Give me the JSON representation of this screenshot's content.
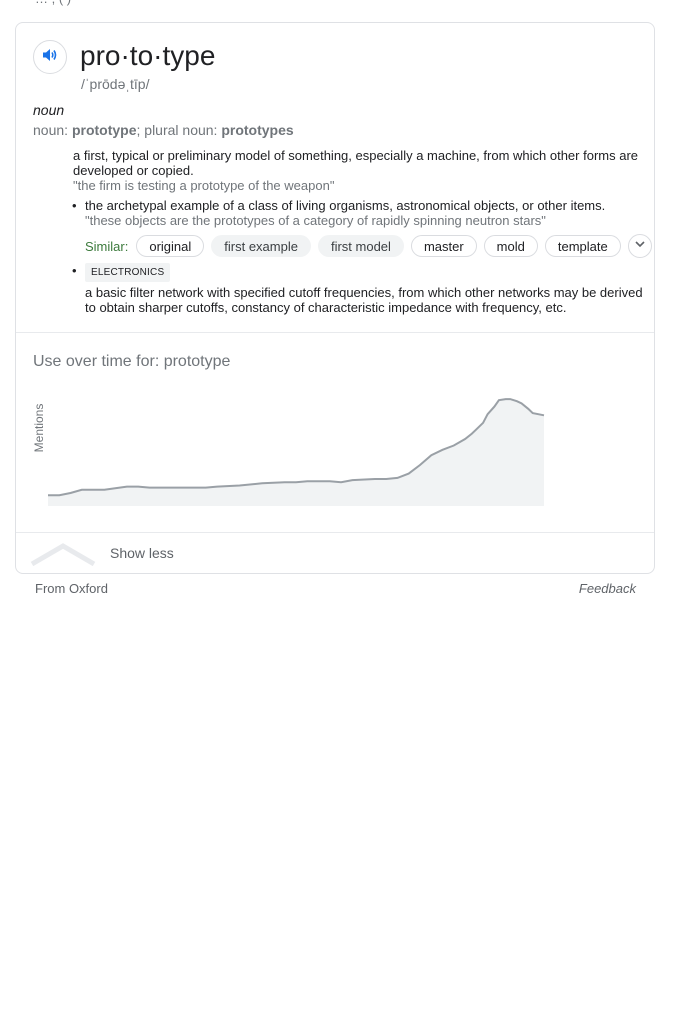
{
  "top_fragment": "…  ,  (             )",
  "entry": {
    "headword": "pro·to·type",
    "pronunciation": "/ˈprōdəˌtīp/",
    "part_of_speech": "noun",
    "forms": {
      "prefix": "noun: ",
      "singular": "prototype",
      "sep": "; plural noun: ",
      "plural": "prototypes"
    },
    "definitions": [
      {
        "text": "a first, typical or preliminary model of something, especially a machine, from which other forms are developed or copied.",
        "example": "\"the firm is testing a prototype of the weapon\""
      }
    ],
    "subsenses": [
      {
        "text": "the archetypal example of a class of living organisms, astronomical objects, or other items.",
        "example": "\"these objects are the prototypes of a category of rapidly spinning neutron stars\""
      },
      {
        "label": "ELECTRONICS",
        "text": "a basic filter network with specified cutoff frequencies, from which other networks may be derived to obtain sharper cutoffs, constancy of characteristic impedance with frequency, etc."
      }
    ],
    "similar_label": "Similar:",
    "similar": [
      "original",
      "first example",
      "first model",
      "master",
      "mold",
      "template"
    ]
  },
  "usage": {
    "title": "Use over time for: prototype"
  },
  "chart_data": {
    "type": "area",
    "title": "Use over time for: prototype",
    "ylabel": "Mentions",
    "xlabel": "",
    "x_ticks": [
      "1800",
      "1850",
      "1900",
      "1950",
      "2010"
    ],
    "xlim": [
      1795,
      2015
    ],
    "ylim": [
      0,
      100
    ],
    "series": [
      {
        "x": [
          1795,
          1800,
          1805,
          1810,
          1820,
          1830,
          1835,
          1840,
          1850,
          1860,
          1865,
          1870,
          1880,
          1890,
          1900,
          1905,
          1910,
          1920,
          1925,
          1930,
          1940,
          1945,
          1950,
          1955,
          1960,
          1965,
          1970,
          1975,
          1980,
          1983,
          1985,
          1988,
          1990,
          1993,
          1995,
          1998,
          2000,
          2003,
          2005,
          2008,
          2010,
          2015
        ],
        "y": [
          10,
          10,
          12,
          15,
          15,
          18,
          18,
          17,
          17,
          17,
          17,
          18,
          19,
          21,
          22,
          22,
          23,
          23,
          22,
          24,
          25,
          25,
          26,
          30,
          38,
          47,
          52,
          56,
          62,
          67,
          71,
          77,
          85,
          92,
          98,
          99,
          99,
          97,
          95,
          90,
          86,
          84
        ]
      }
    ],
    "grid": false,
    "legend": "none"
  },
  "footer": {
    "show_less": "Show less",
    "source": "From Oxford",
    "feedback": "Feedback"
  }
}
